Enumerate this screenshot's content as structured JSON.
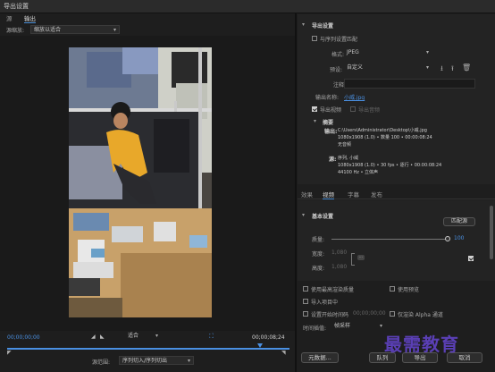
{
  "window": {
    "title": "导出设置"
  },
  "source_tabs": [
    {
      "label": "源"
    },
    {
      "label": "输出"
    }
  ],
  "scaling": {
    "label": "源缩放:",
    "value": "缩放以适合"
  },
  "timeline": {
    "start_time": "00;00;00;00",
    "end_time": "00;00;08;24",
    "fit_value": "适合"
  },
  "source_range": {
    "label": "源范围:",
    "value": "序列切入/序列切出"
  },
  "export_settings": {
    "header": "导出设置",
    "match_sequence": "与序列设置匹配",
    "format_label": "格式:",
    "format_value": "JPEG",
    "preset_label": "预设:",
    "preset_value": "自定义",
    "comment_label": "注释:",
    "output_name_label": "输出名称:",
    "output_name_value": "小威.jpg",
    "export_video": "导出视频",
    "export_audio": "导出音频",
    "summary_header": "摘要",
    "output_label": "输出:",
    "output_lines": [
      "C:\\Users\\Administrator\\Desktop\\小威.jpg",
      "1080x1908 (1.0) • 数量 100 • 00:00:08:24",
      "无音频"
    ],
    "source_label": "源:",
    "source_lines": [
      "序列, 小威",
      "1080x1908 (1.0) • 30 fps • 逐行 • 00:00:08:24",
      "44100 Hz • 立体声"
    ]
  },
  "settings_tabs": [
    {
      "label": "效果"
    },
    {
      "label": "视频"
    },
    {
      "label": "字幕"
    },
    {
      "label": "发布"
    }
  ],
  "basic_settings": {
    "header": "基本设置",
    "match_source": "匹配源",
    "quality_label": "质量:",
    "quality_value": "100",
    "width_label": "宽度:",
    "width_value": "1,080",
    "height_label": "高度:",
    "height_value": "1,080"
  },
  "render_options": {
    "max_quality": "使用最高渲染质量",
    "use_previews": "使用预览",
    "import_project": "导入项目中",
    "set_start_timecode": "设置开始时间码",
    "timecode_value": "00;00;00;00",
    "render_alpha": "仅渲染 Alpha 通道",
    "interp_label": "时间插值:",
    "interp_value": "帧采样"
  },
  "buttons": {
    "metadata": "元数据...",
    "queue": "队列",
    "export": "导出",
    "cancel": "取消"
  },
  "watermark": "最需教育",
  "colors": {
    "accent": "#4a90e2",
    "watermark": "#5a3fb5"
  }
}
